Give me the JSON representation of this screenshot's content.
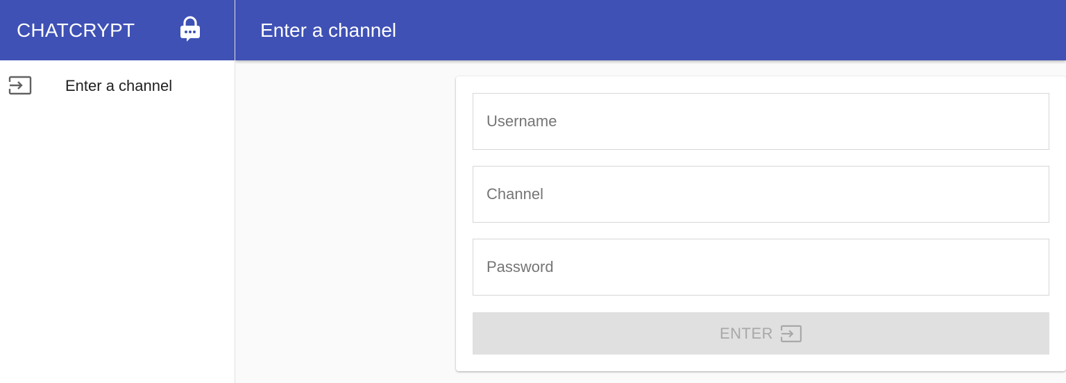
{
  "sidebar": {
    "brand": "CHATCRYPT",
    "brand_icon": "lock-chat-icon",
    "items": [
      {
        "label": "Enter a channel",
        "icon": "login-icon"
      }
    ]
  },
  "appbar": {
    "title": "Enter a channel"
  },
  "form": {
    "username": {
      "placeholder": "Username",
      "value": ""
    },
    "channel": {
      "placeholder": "Channel",
      "value": ""
    },
    "password": {
      "placeholder": "Password",
      "value": ""
    },
    "enter_label": "ENTER",
    "enter_icon": "login-icon"
  },
  "colors": {
    "primary": "#3f51b5",
    "disabled_button": "#e0e0e0",
    "disabled_text": "#a8a8a8"
  }
}
